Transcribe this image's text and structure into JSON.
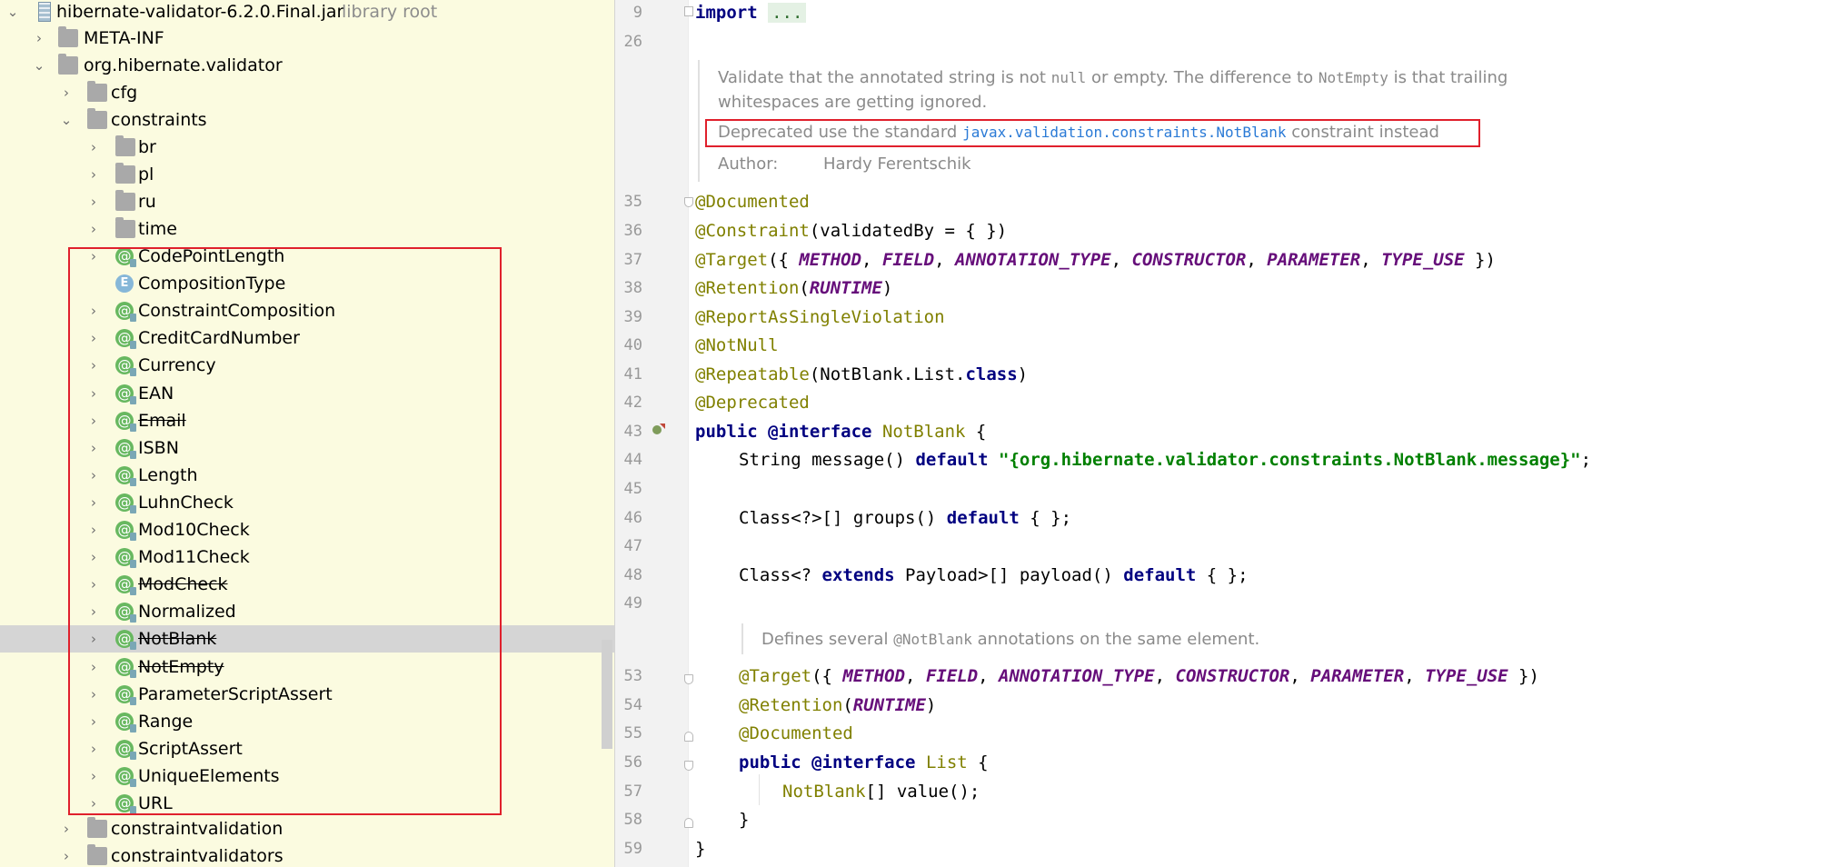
{
  "tree": {
    "root": {
      "label": "hibernate-validator-6.2.0.Final.jar",
      "sublabel": "library root"
    },
    "meta_inf": "META-INF",
    "package": "org.hibernate.validator",
    "cfg": "cfg",
    "constraints": "constraints",
    "subfolders": [
      "br",
      "pl",
      "ru",
      "time"
    ],
    "items": [
      {
        "label": "CodePointLength",
        "icon": "annotation-icon",
        "deprecated": false
      },
      {
        "label": "CompositionType",
        "icon": "enum-icon",
        "deprecated": false
      },
      {
        "label": "ConstraintComposition",
        "icon": "annotation-icon",
        "deprecated": false
      },
      {
        "label": "CreditCardNumber",
        "icon": "annotation-icon",
        "deprecated": false
      },
      {
        "label": "Currency",
        "icon": "annotation-icon",
        "deprecated": false
      },
      {
        "label": "EAN",
        "icon": "annotation-icon",
        "deprecated": false
      },
      {
        "label": "Email",
        "icon": "annotation-icon",
        "deprecated": true
      },
      {
        "label": "ISBN",
        "icon": "annotation-icon",
        "deprecated": false
      },
      {
        "label": "Length",
        "icon": "annotation-icon",
        "deprecated": false
      },
      {
        "label": "LuhnCheck",
        "icon": "annotation-icon",
        "deprecated": false
      },
      {
        "label": "Mod10Check",
        "icon": "annotation-icon",
        "deprecated": false
      },
      {
        "label": "Mod11Check",
        "icon": "annotation-icon",
        "deprecated": false
      },
      {
        "label": "ModCheck",
        "icon": "annotation-icon",
        "deprecated": true
      },
      {
        "label": "Normalized",
        "icon": "annotation-icon",
        "deprecated": false
      },
      {
        "label": "NotBlank",
        "icon": "annotation-icon",
        "deprecated": true,
        "selected": true
      },
      {
        "label": "NotEmpty",
        "icon": "annotation-icon",
        "deprecated": true
      },
      {
        "label": "ParameterScriptAssert",
        "icon": "annotation-icon",
        "deprecated": false
      },
      {
        "label": "Range",
        "icon": "annotation-icon",
        "deprecated": false
      },
      {
        "label": "ScriptAssert",
        "icon": "annotation-icon",
        "deprecated": false
      },
      {
        "label": "UniqueElements",
        "icon": "annotation-icon",
        "deprecated": false
      },
      {
        "label": "URL",
        "icon": "annotation-icon",
        "deprecated": false
      }
    ],
    "after": [
      "constraintvalidation",
      "constraintvalidators"
    ]
  },
  "editor": {
    "line_numbers": {
      "l9": "9",
      "l26": "26",
      "l35": "35",
      "l36": "36",
      "l37": "37",
      "l38": "38",
      "l39": "39",
      "l40": "40",
      "l41": "41",
      "l42": "42",
      "l43": "43",
      "l44": "44",
      "l45": "45",
      "l46": "46",
      "l47": "47",
      "l48": "48",
      "l49": "49",
      "l53": "53",
      "l54": "54",
      "l55": "55",
      "l56": "56",
      "l57": "57",
      "l58": "58",
      "l59": "59"
    },
    "import_kw": "import",
    "import_fold": "...",
    "doc1": {
      "line1_a": "Validate that the annotated string is not ",
      "line1_null": "null",
      "line1_b": " or empty. The difference to ",
      "line1_notempty": "NotEmpty",
      "line1_c": " is that trailing",
      "line2": "whitespaces are getting ignored.",
      "deprecated_a": "Deprecated use the standard ",
      "deprecated_link": "javax.validation.constraints.NotBlank",
      "deprecated_b": " constraint instead",
      "author_label": "Author:",
      "author_name": "Hardy Ferentschik"
    },
    "doc2": {
      "a": "Defines several ",
      "code": "@NotBlank",
      "b": " annotations on the same element."
    },
    "tokens": {
      "documented": "@Documented",
      "constraint": "@Constraint",
      "constraint_args": "(validatedBy = { })",
      "target": "@Target",
      "open": "({ ",
      "close": " })",
      "comma": ", ",
      "method": "METHOD",
      "field": "FIELD",
      "annotation_type": "ANNOTATION_TYPE",
      "constructor": "CONSTRUCTOR",
      "parameter": "PARAMETER",
      "type_use": "TYPE_USE",
      "retention": "@Retention",
      "lp": "(",
      "rp": ")",
      "runtime": "RUNTIME",
      "report": "@ReportAsSingleViolation",
      "notnull": "@NotNull",
      "repeatable": "@Repeatable",
      "notblank_list": "NotBlank.List.",
      "class_kw": "class",
      "deprecated": "@Deprecated",
      "public": "public",
      "interface": "@interface",
      "notblank_name": "NotBlank",
      "brace": " {",
      "string_msg": "String message() ",
      "default": "default",
      "msg_value": "\"{org.hibernate.validator.constraints.NotBlank.message}\"",
      "semi": ";",
      "class_groups": "Class<?>[] groups() ",
      "empty_arr": " { };",
      "class_payload_a": "Class<? ",
      "extends": "extends",
      "class_payload_b": " Payload>[] payload() ",
      "list_name": "List",
      "notblank_arr": "NotBlank",
      "value_decl": "[] value();",
      "close_brace": "}"
    }
  },
  "colors": {
    "highlight_border": "#e0202c",
    "tree_bg": "#fbfbe0",
    "keyword": "#000080",
    "annotation": "#808000",
    "constant": "#660e7a",
    "string": "#008000"
  }
}
